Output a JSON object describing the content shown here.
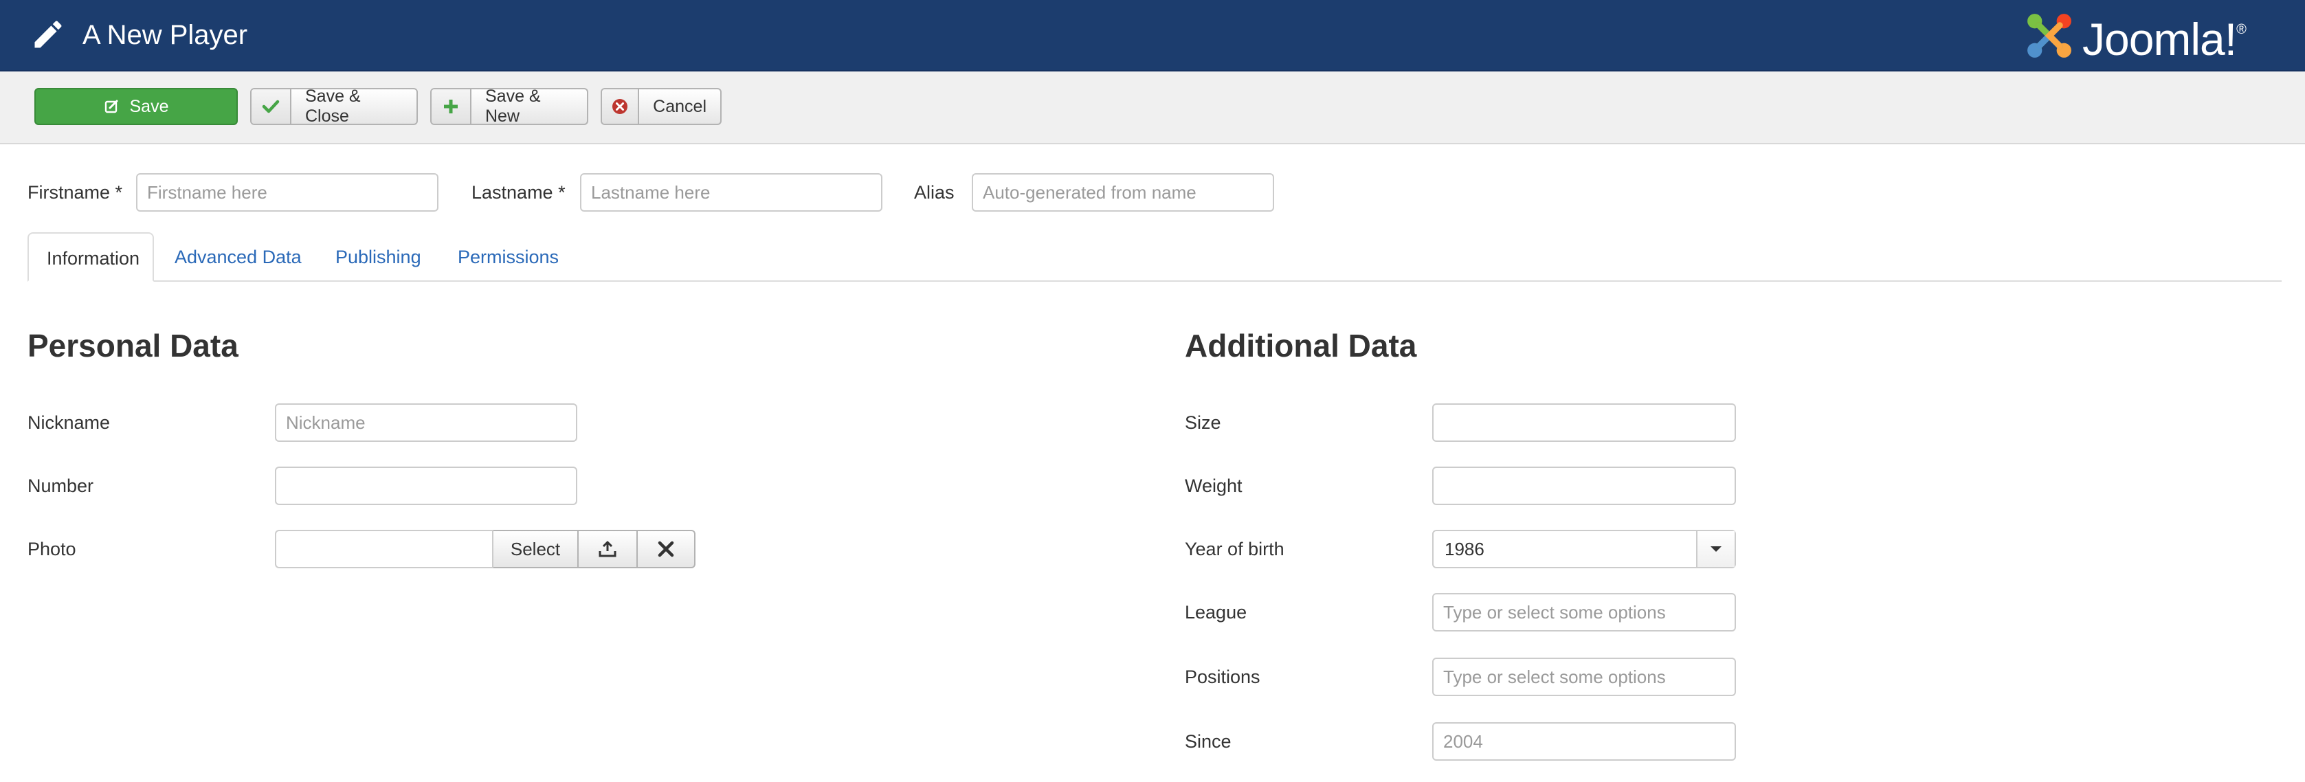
{
  "header": {
    "title": "A New Player",
    "edit_icon": "pencil-icon",
    "logo_text": "Joomla!",
    "logo_mark": "®"
  },
  "toolbar": {
    "save_label": "Save",
    "save_close_label": "Save & Close",
    "save_new_label": "Save & New",
    "cancel_label": "Cancel",
    "colors": {
      "save": "#46a546",
      "check": "#46a546",
      "plus": "#46a546",
      "cancel": "#bd362f"
    }
  },
  "title_fields": {
    "firstname_label": "Firstname *",
    "firstname_placeholder": "Firstname here",
    "lastname_label": "Lastname *",
    "lastname_placeholder": "Lastname here",
    "alias_label": "Alias",
    "alias_placeholder": "Auto-generated from name"
  },
  "tabs": [
    {
      "label": "Information",
      "active": true
    },
    {
      "label": "Advanced Data",
      "active": false
    },
    {
      "label": "Publishing",
      "active": false
    },
    {
      "label": "Permissions",
      "active": false
    }
  ],
  "personal": {
    "heading": "Personal Data",
    "nickname_label": "Nickname",
    "nickname_placeholder": "Nickname",
    "number_label": "Number",
    "photo_label": "Photo",
    "photo_select_label": "Select"
  },
  "additional": {
    "heading": "Additional Data",
    "size_label": "Size",
    "weight_label": "Weight",
    "year_label": "Year of birth",
    "year_value": "1986",
    "league_label": "League",
    "league_placeholder": "Type or select some options",
    "positions_label": "Positions",
    "positions_placeholder": "Type or select some options",
    "since_label": "Since",
    "since_placeholder": "2004"
  }
}
